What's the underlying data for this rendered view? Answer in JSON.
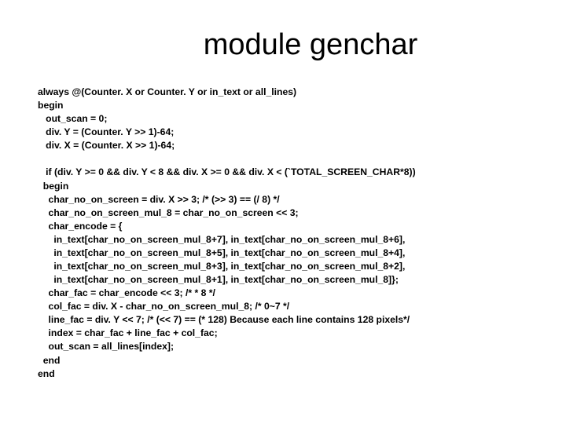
{
  "title": "module genchar",
  "code": "always @(Counter. X or Counter. Y or in_text or all_lines)\nbegin\n   out_scan = 0;\n   div. Y = (Counter. Y >> 1)-64;\n   div. X = (Counter. X >> 1)-64;\n\n   if (div. Y >= 0 && div. Y < 8 && div. X >= 0 && div. X < (`TOTAL_SCREEN_CHAR*8))\n  begin\n    char_no_on_screen = div. X >> 3; /* (>> 3) == (/ 8) */\n    char_no_on_screen_mul_8 = char_no_on_screen << 3;\n    char_encode = {\n      in_text[char_no_on_screen_mul_8+7], in_text[char_no_on_screen_mul_8+6],\n      in_text[char_no_on_screen_mul_8+5], in_text[char_no_on_screen_mul_8+4],\n      in_text[char_no_on_screen_mul_8+3], in_text[char_no_on_screen_mul_8+2],\n      in_text[char_no_on_screen_mul_8+1], in_text[char_no_on_screen_mul_8]};\n    char_fac = char_encode << 3; /* * 8 */\n    col_fac = div. X - char_no_on_screen_mul_8; /* 0~7 */\n    line_fac = div. Y << 7; /* (<< 7) == (* 128) Because each line contains 128 pixels*/\n    index = char_fac + line_fac + col_fac;\n    out_scan = all_lines[index];\n  end\nend"
}
